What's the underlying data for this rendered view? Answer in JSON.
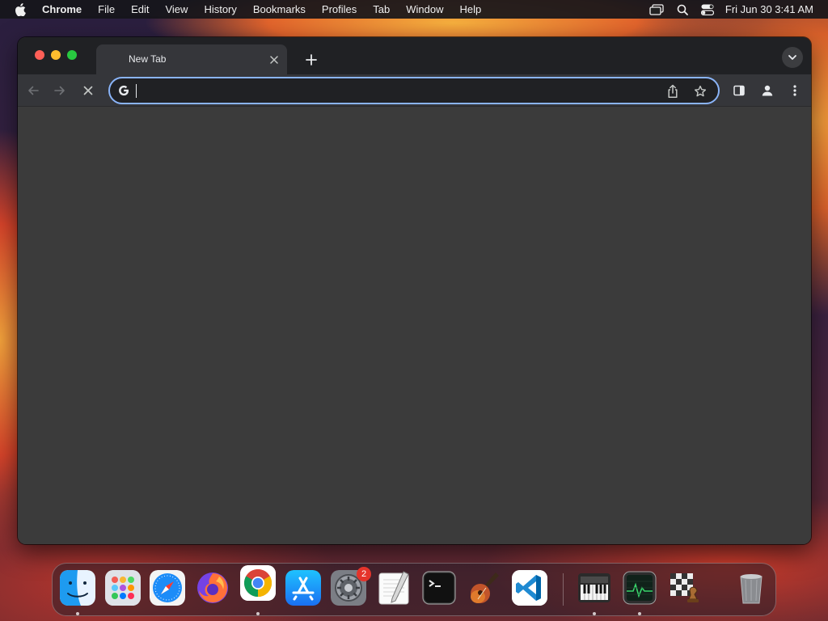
{
  "menubar": {
    "app_name": "Chrome",
    "menus": [
      "File",
      "Edit",
      "View",
      "History",
      "Bookmarks",
      "Profiles",
      "Tab",
      "Window",
      "Help"
    ],
    "clock": "Fri Jun 30  3:41 AM"
  },
  "browser": {
    "tab": {
      "title": "New Tab"
    },
    "omnibox": {
      "value": "",
      "placeholder": ""
    }
  },
  "dock": {
    "items": [
      {
        "name": "Finder",
        "icon": "finder-icon",
        "running": true
      },
      {
        "name": "Launchpad",
        "icon": "launchpad-icon",
        "running": false
      },
      {
        "name": "Safari",
        "icon": "safari-icon",
        "running": false
      },
      {
        "name": "Firefox",
        "icon": "firefox-icon",
        "running": false
      },
      {
        "name": "Google Chrome",
        "icon": "chrome-icon",
        "running": true
      },
      {
        "name": "App Store",
        "icon": "app-store-icon",
        "running": false
      },
      {
        "name": "System Settings",
        "icon": "system-settings-icon",
        "running": false,
        "badge": "2"
      },
      {
        "name": "TextEdit",
        "icon": "textedit-icon",
        "running": false
      },
      {
        "name": "Terminal",
        "icon": "terminal-icon",
        "running": false
      },
      {
        "name": "GarageBand",
        "icon": "garageband-icon",
        "running": false
      },
      {
        "name": "Visual Studio Code",
        "icon": "vscode-icon",
        "running": false
      },
      {
        "name": "MIDI Keyboard",
        "icon": "piano-icon",
        "running": true
      },
      {
        "name": "Activity Monitor",
        "icon": "activity-monitor-icon",
        "running": true
      },
      {
        "name": "Chess",
        "icon": "chess-icon",
        "running": false
      },
      {
        "name": "Trash",
        "icon": "trash-icon",
        "running": false
      }
    ]
  },
  "colors": {
    "accent": "#8ab4f8",
    "window_bg": "#3b3b3b",
    "tabstrip_bg": "#202124",
    "toolbar_bg": "#35363a"
  }
}
